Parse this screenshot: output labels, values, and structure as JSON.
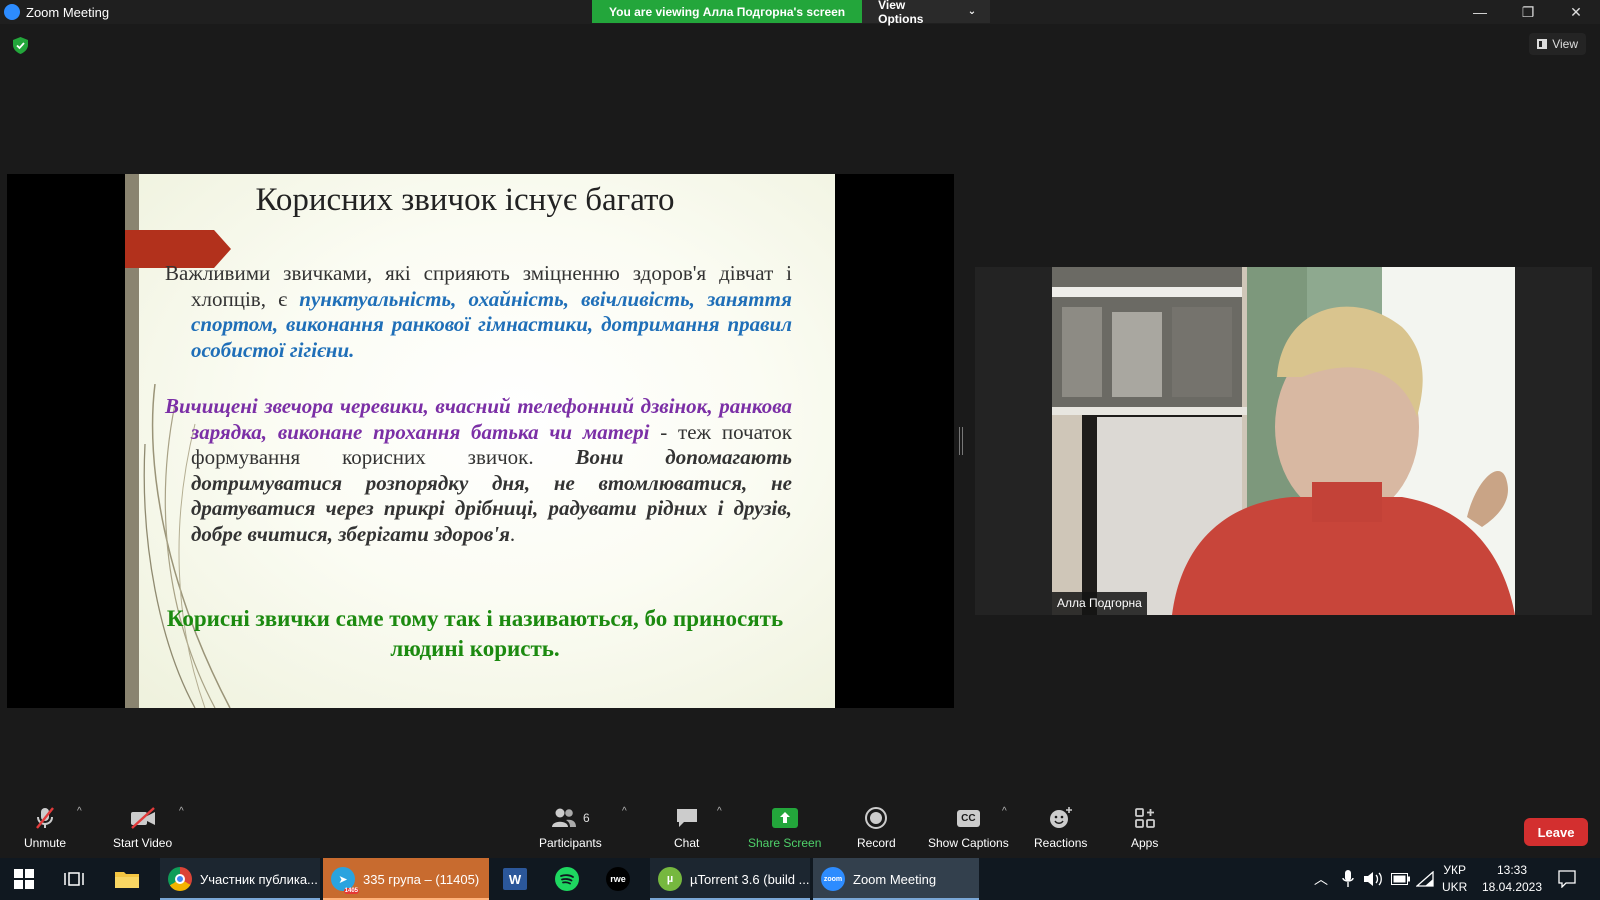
{
  "window": {
    "title": "Zoom Meeting"
  },
  "banner": {
    "viewing": "You are viewing Алла Подгорна's screen",
    "view_options": "View Options"
  },
  "top_right": {
    "view_label": "View"
  },
  "slide": {
    "title": "Корисних звичок існує багато",
    "p1_a": "Важливими звичками, які сприяють зміцненню здоров'я дівчат і хлопців, є ",
    "p1_b": "пунктуальність, охайність, ввічливість, заняття спортом, виконання ранкової гімнастики, дотримання правил особистої гігієни.",
    "p2_a": "Вичищені звечора черевики, вчасний телефонний дзвінок, ранкова зарядка, виконане прохання батька чи матері",
    "p2_b": " - теж початок формування корисних звичок. ",
    "p2_c": "Вони допомагають дотримуватися розпорядку дня, не втомлюватися, не дратуватися через прикрі дрібниці, радувати рідних і друзів, добре вчитися, зберігати здоров'я",
    "p2_d": ".",
    "p3": "Корисні звички саме тому так і називаються, бо приносять людині користь."
  },
  "participant": {
    "name": "Алла Подгорна"
  },
  "toolbar": {
    "unmute": "Unmute",
    "start_video": "Start Video",
    "participants": "Participants",
    "participants_count": "6",
    "chat": "Chat",
    "share_screen": "Share Screen",
    "record": "Record",
    "show_captions": "Show Captions",
    "captions_icon_text": "CC",
    "reactions": "Reactions",
    "apps": "Apps",
    "leave": "Leave"
  },
  "taskbar": {
    "chrome": "Участник публика...",
    "telegram": "335 група – (11405)",
    "telegram_badge": "1405",
    "word_letter": "W",
    "rwe_label": "rwe",
    "utorrent": "µTorrent 3.6  (build ...",
    "zoom": "Zoom Meeting",
    "zoom_logo_text": "zoom",
    "lang_top": "УКР",
    "lang_bottom": "UKR",
    "time": "13:33",
    "date": "18.04.2023"
  },
  "colors": {
    "share_green": "#23a63b",
    "leave_red": "#d32f2f",
    "slide_blue": "#1f6fb8",
    "slide_purple": "#7b2fa6",
    "slide_green": "#1c8a10"
  }
}
